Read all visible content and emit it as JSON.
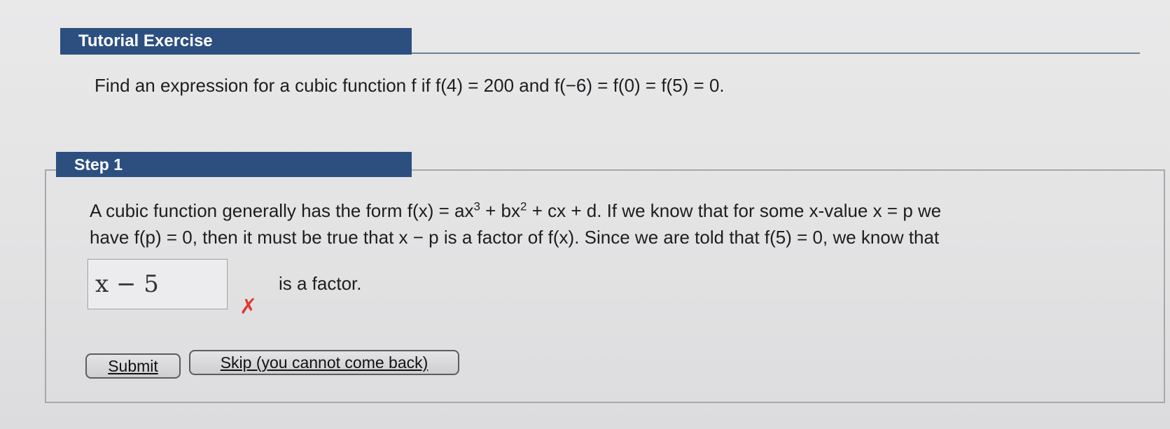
{
  "header": {
    "title": "Tutorial Exercise"
  },
  "problem": {
    "text": "Find an expression for a cubic function f if f(4) = 200 and f(−6) = f(0) = f(5) = 0."
  },
  "step": {
    "title": "Step 1",
    "line1_a": "A cubic function generally has the form f(x) = ax",
    "line1_b": " + bx",
    "line1_c": " + cx + d. If we know that for some x-value x = p we",
    "exp3": "3",
    "exp2": "2",
    "line2": "have f(p) = 0, then it must be true that x − p is a factor of f(x). Since we are told that f(5) = 0, we know that",
    "answer_value": "x − 5",
    "after_answer": "is a factor."
  },
  "feedback": {
    "wrong_symbol": "✗"
  },
  "buttons": {
    "submit_label": "Submit",
    "skip_label": "Skip (you cannot come back)"
  }
}
